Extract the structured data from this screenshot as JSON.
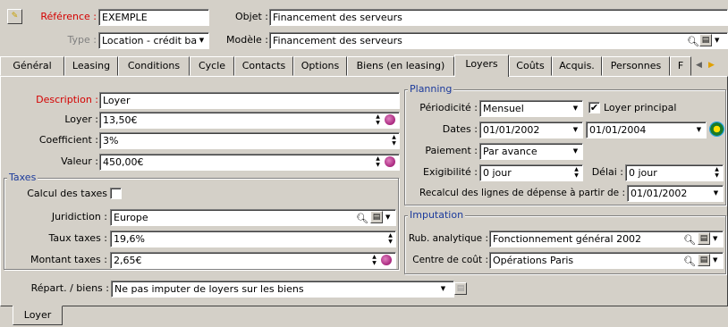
{
  "header": {
    "reference_label": "Référence :",
    "reference_value": "EXEMPLE",
    "objet_label": "Objet :",
    "objet_value": "Financement des serveurs",
    "type_label": "Type :",
    "type_value": "Location - crédit ba",
    "modele_label": "Modèle :",
    "modele_value": "Financement des serveurs"
  },
  "tabs": [
    {
      "label": "Général"
    },
    {
      "label": "Leasing"
    },
    {
      "label": "Conditions"
    },
    {
      "label": "Cycle"
    },
    {
      "label": "Contacts"
    },
    {
      "label": "Options"
    },
    {
      "label": "Biens (en leasing)"
    },
    {
      "label": "Loyers"
    },
    {
      "label": "Coûts"
    },
    {
      "label": "Acquis."
    },
    {
      "label": "Personnes"
    },
    {
      "label": "F"
    }
  ],
  "active_tab": "Loyers",
  "left": {
    "description_label": "Description :",
    "description_value": "Loyer",
    "loyer_label": "Loyer :",
    "loyer_value": "13,50€",
    "coefficient_label": "Coefficient :",
    "coefficient_value": "3%",
    "valeur_label": "Valeur :",
    "valeur_value": "450,00€",
    "taxes_group": "Taxes",
    "calcul_label": "Calcul des taxes",
    "calcul_checked": false,
    "juridiction_label": "Juridiction :",
    "juridiction_value": "Europe",
    "taux_label": "Taux taxes :",
    "taux_value": "19,6%",
    "montant_label": "Montant taxes :",
    "montant_value": "2,65€"
  },
  "planning": {
    "group": "Planning",
    "periodicite_label": "Périodicité :",
    "periodicite_value": "Mensuel",
    "loyer_principal_label": "Loyer principal",
    "loyer_principal_checked": true,
    "dates_label": "Dates :",
    "date_start": "01/01/2002",
    "date_end": "01/01/2004",
    "paiement_label": "Paiement :",
    "paiement_value": "Par avance",
    "exigibilite_label": "Exigibilité :",
    "exigibilite_value": "0 jour",
    "delai_label": "Délai :",
    "delai_value": "0 jour",
    "recalcul_label": "Recalcul des lignes de dépense à partir de :",
    "recalcul_value": "01/01/2002"
  },
  "imputation": {
    "group": "Imputation",
    "rubrique_label": "Rub. analytique :",
    "rubrique_value": "Fonctionnement général 2002",
    "centre_label": "Centre de coût :",
    "centre_value": "Opérations Paris"
  },
  "repart": {
    "label": "Répart. / biens :",
    "value": "Ne pas imputer de loyers sur les biens"
  },
  "bottom_tab": "Loyer",
  "icons": {
    "header": "wizard-pen-icon",
    "date": "calendar-clock-icon",
    "lookup": "magnifier-icon",
    "detail": "form-icon",
    "calc": "calculator-icon"
  }
}
